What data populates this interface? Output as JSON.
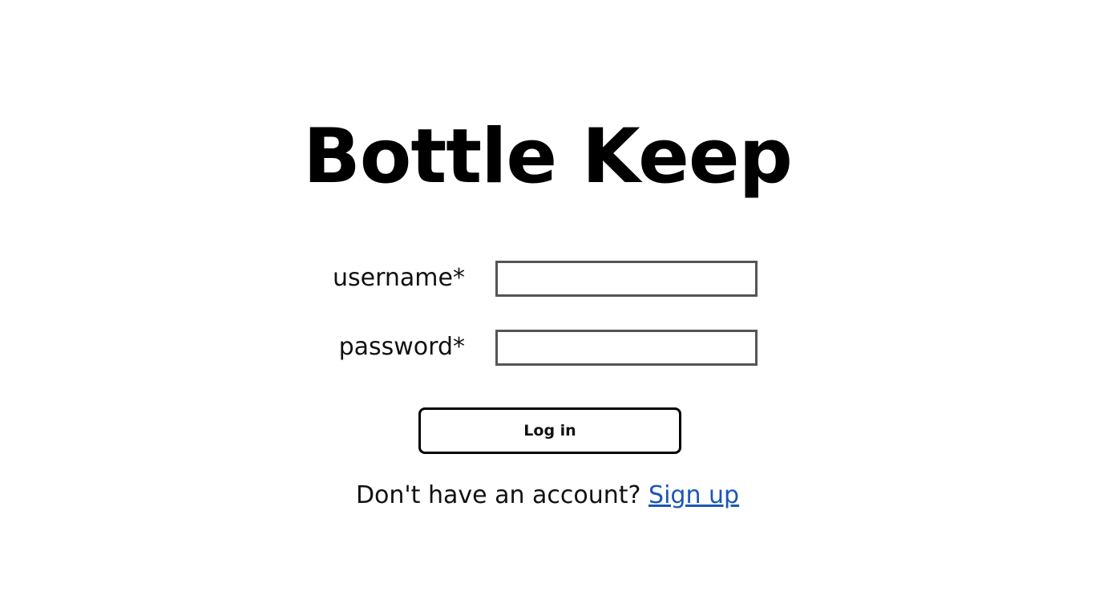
{
  "app": {
    "title": "Bottle Keep"
  },
  "login_form": {
    "username": {
      "label": "username*",
      "value": "",
      "placeholder": ""
    },
    "password": {
      "label": "password*",
      "value": "",
      "placeholder": ""
    },
    "submit_label": "Log in"
  },
  "signup": {
    "prompt": "Don't have an account?",
    "link_label": "Sign up"
  },
  "colors": {
    "link": "#1a56b8",
    "input_border": "#555555",
    "button_border": "#000000",
    "background": "#ffffff"
  }
}
